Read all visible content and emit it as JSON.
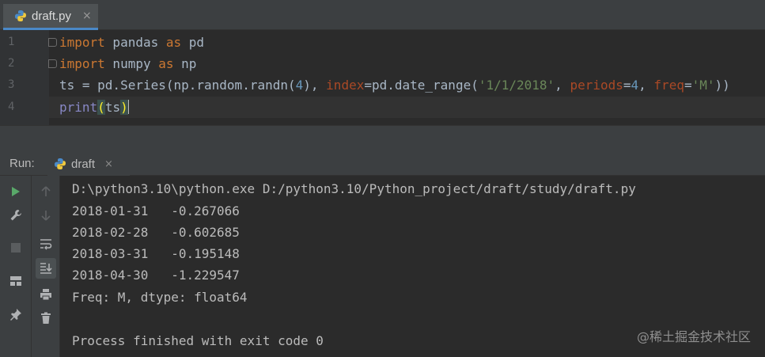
{
  "editor": {
    "tab": {
      "label": "draft.py",
      "close": "×"
    },
    "lines": [
      {
        "num": "1",
        "parts": [
          [
            "kw",
            "import"
          ],
          [
            "",
            " pandas "
          ],
          [
            "kw",
            "as"
          ],
          [
            "",
            " pd"
          ]
        ]
      },
      {
        "num": "2",
        "parts": [
          [
            "kw",
            "import"
          ],
          [
            "",
            " numpy "
          ],
          [
            "kw",
            "as"
          ],
          [
            "",
            " np"
          ]
        ]
      },
      {
        "num": "3",
        "parts": [
          [
            "",
            "ts = pd.Series(np.random.randn("
          ],
          [
            "num",
            "4"
          ],
          [
            "",
            "), "
          ],
          [
            "param",
            "index"
          ],
          [
            "",
            "=pd.date_range("
          ],
          [
            "str",
            "'1/1/2018'"
          ],
          [
            "",
            ", "
          ],
          [
            "param",
            "periods"
          ],
          [
            "",
            "="
          ],
          [
            "num",
            "4"
          ],
          [
            "",
            ", "
          ],
          [
            "param",
            "freq"
          ],
          [
            "",
            "="
          ],
          [
            "str",
            "'M'"
          ],
          [
            "",
            "))"
          ]
        ]
      },
      {
        "num": "4",
        "parts": [
          [
            "builtin",
            "print"
          ],
          [
            "paren",
            "("
          ],
          [
            "",
            "ts"
          ],
          [
            "paren",
            ")"
          ]
        ]
      }
    ]
  },
  "run": {
    "label": "Run:",
    "tab": {
      "label": "draft",
      "close": "×"
    }
  },
  "console": {
    "lines": [
      "D:\\python3.10\\python.exe D:/python3.10/Python_project/draft/study/draft.py",
      "2018-01-31   -0.267066",
      "2018-02-28   -0.602685",
      "2018-03-31   -0.195148",
      "2018-04-30   -1.229547",
      "Freq: M, dtype: float64",
      "",
      "Process finished with exit code 0"
    ]
  },
  "watermark": "@稀土掘金技术社区",
  "colors": {
    "keyword": "#cc7832",
    "string": "#6a8759",
    "number": "#6897bb",
    "param": "#aa4926",
    "builtin": "#8888c6",
    "run_green": "#59a869"
  }
}
